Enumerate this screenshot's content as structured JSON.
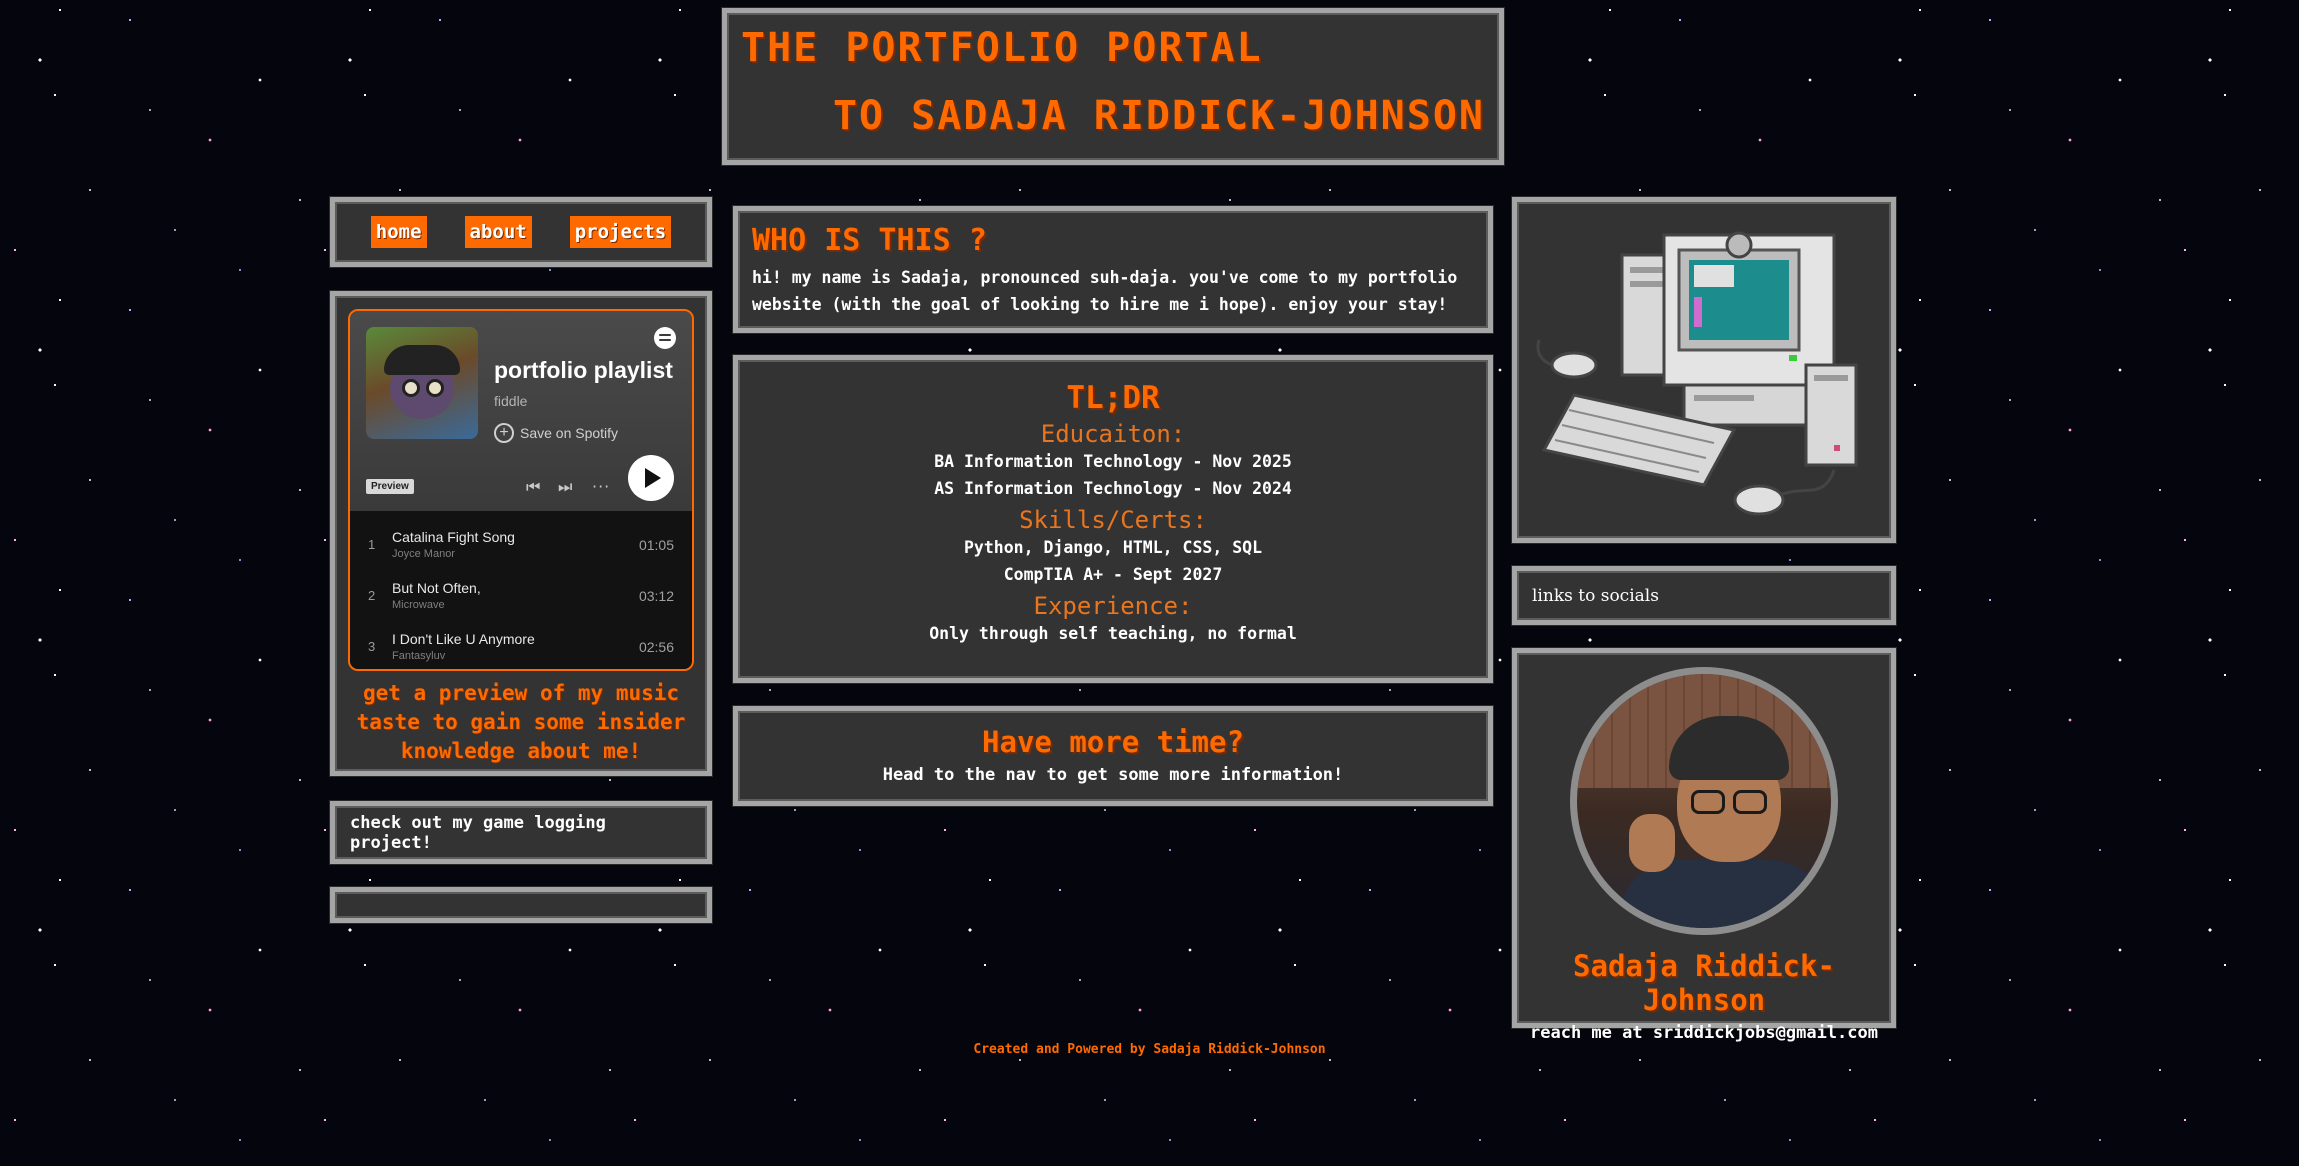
{
  "header": {
    "line1": "THE PORTFOLIO PORTAL",
    "line2": "TO SADAJA RIDDICK-JOHNSON"
  },
  "nav": {
    "items": [
      {
        "label": "home"
      },
      {
        "label": "about"
      },
      {
        "label": "projects"
      }
    ]
  },
  "music": {
    "embed": {
      "title": "portfolio playlist",
      "owner": "fiddle",
      "save_label": "Save on Spotify",
      "preview_badge": "Preview",
      "more_symbol": "···",
      "tracks": [
        {
          "num": "1",
          "name": "Catalina Fight Song",
          "artist": "Joyce Manor",
          "duration": "01:05"
        },
        {
          "num": "2",
          "name": "But Not Often,",
          "artist": "Microwave",
          "duration": "03:12"
        },
        {
          "num": "3",
          "name": "I Don't Like U Anymore",
          "artist": "Fantasyluv",
          "duration": "02:56"
        }
      ]
    },
    "caption": "get a preview of my music taste to gain some insider knowledge about me!"
  },
  "game_project": {
    "label": "check out my game logging project!"
  },
  "who": {
    "heading": "WHO IS THIS ?",
    "text": "hi! my name is Sadaja, pronounced suh-daja. you've come to my portfolio website (with the goal of looking to hire me i hope). enjoy your stay!"
  },
  "tldr": {
    "heading": "TL;DR",
    "education_heading": "Educaiton:",
    "education": [
      "BA Information Technology - Nov 2025",
      "AS Information Technology - Nov 2024"
    ],
    "skills_heading": "Skills/Certs:",
    "skills": [
      "Python, Django, HTML, CSS, SQL",
      "CompTIA A+ - Sept 2027"
    ],
    "experience_heading": "Experience:",
    "experience": [
      "Only through self teaching, no formal"
    ]
  },
  "more": {
    "heading": "Have more time?",
    "text": "Head to the nav to get some more information!"
  },
  "socials": {
    "label": "links to socials"
  },
  "profile": {
    "name": "Sadaja Riddick-Johnson",
    "contact": "reach me at sriddickjobs@gmail.com"
  },
  "footer": {
    "text": "Created and Powered by Sadaja Riddick-Johnson"
  },
  "colors": {
    "accent": "#ff6a00",
    "panel": "#333333",
    "border": "#a5a5a5"
  }
}
